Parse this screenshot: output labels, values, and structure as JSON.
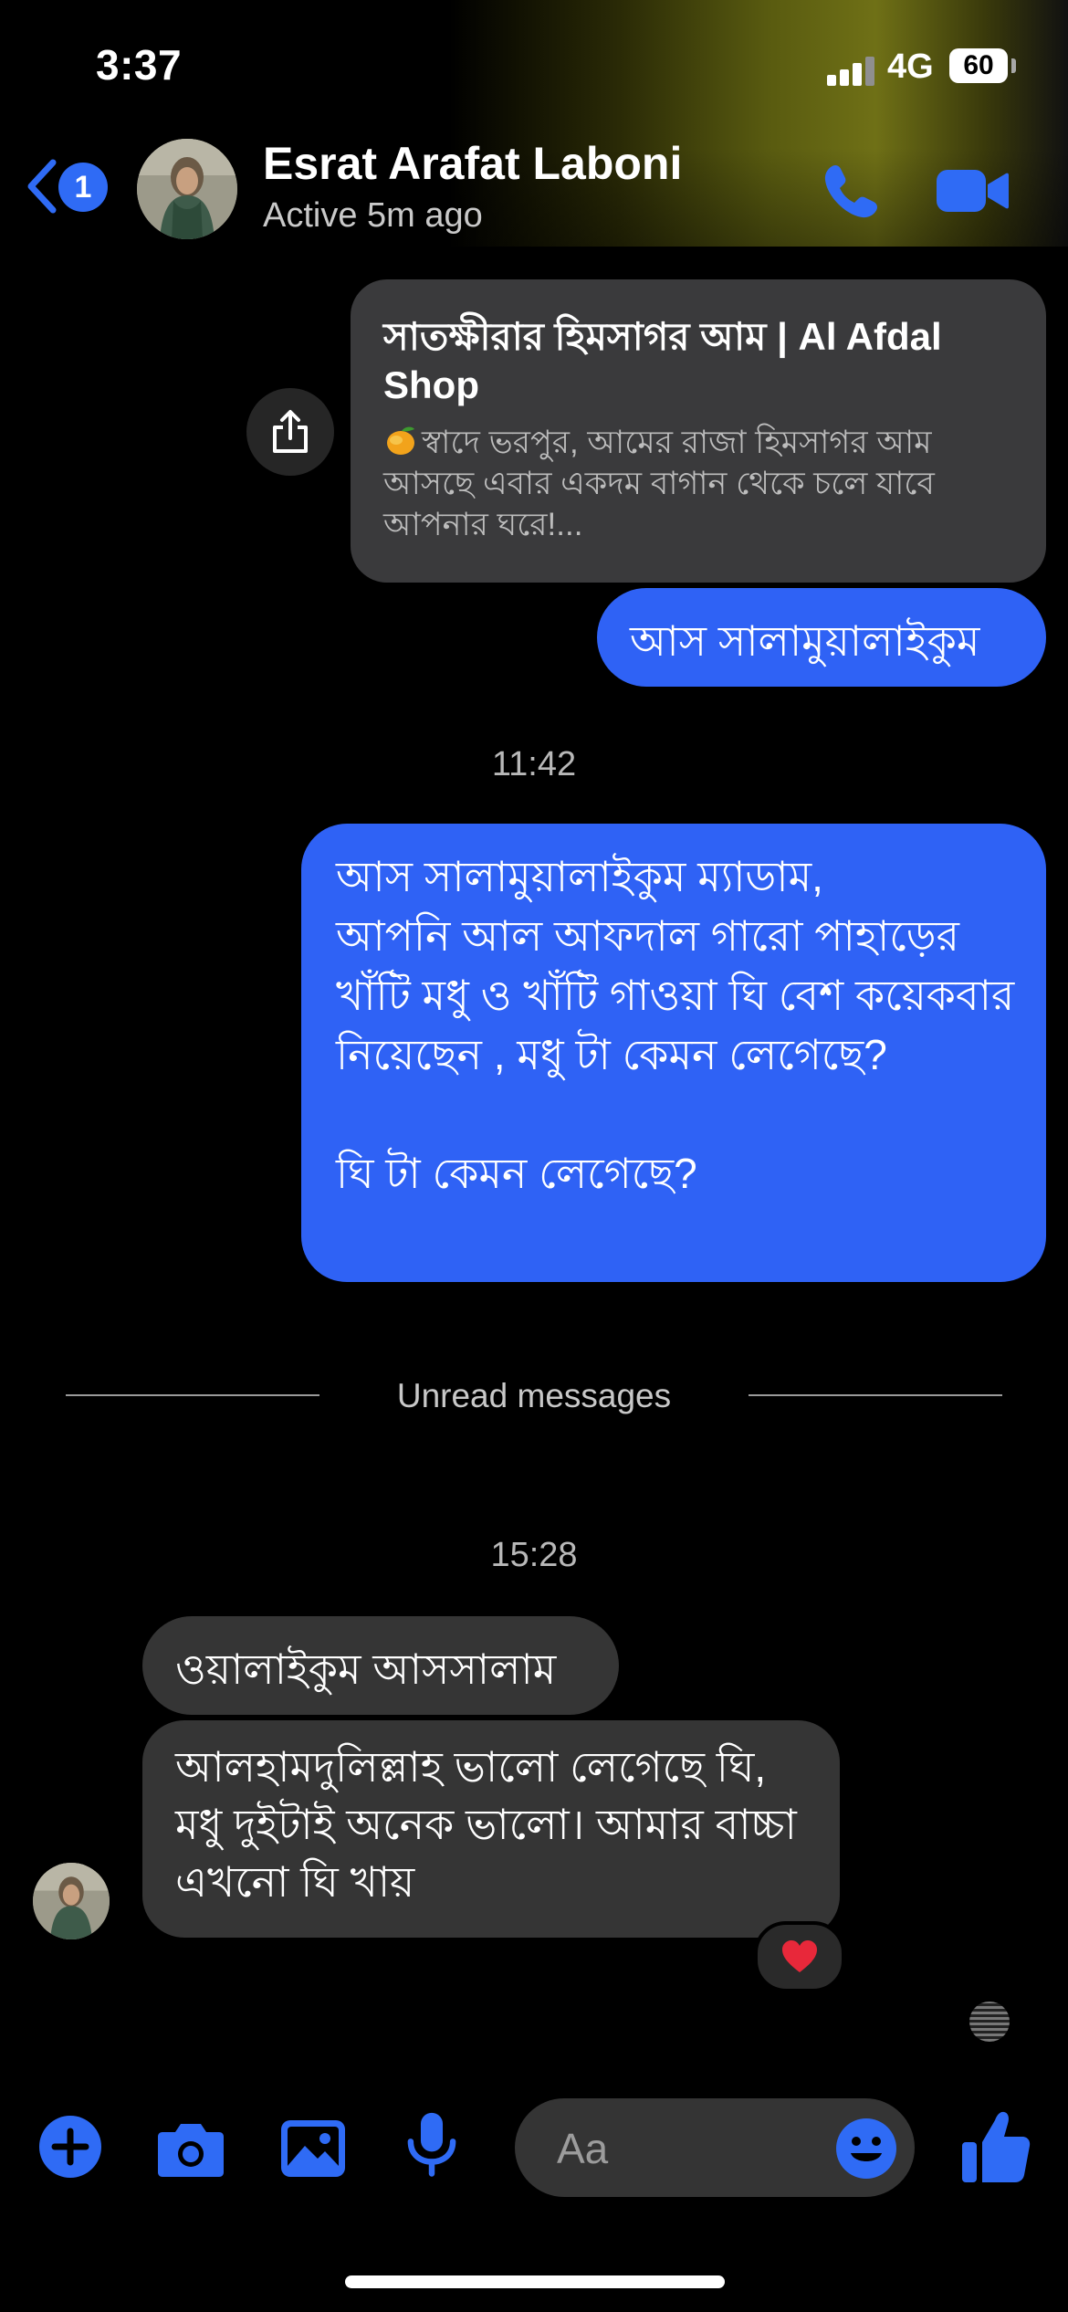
{
  "status_bar": {
    "time": "3:37",
    "network": "4G",
    "battery": "60"
  },
  "header": {
    "back_badge": "1",
    "contact_name": "Esrat Arafat Laboni",
    "contact_status": "Active 5m ago"
  },
  "link_preview": {
    "title": "সাতক্ষীরার হিমসাগর আম | Al Afdal Shop",
    "description": "স্বাদে ভরপুর, আমের রাজা হিমসাগর আম আসছে এবার একদম বাগান থেকে চলে যাবে আপনার ঘরে!..."
  },
  "messages": [
    {
      "from": "me",
      "text": "আস সালামুয়ালাইকুম"
    },
    {
      "timestamp": "11:42"
    },
    {
      "from": "me",
      "text": "আস সালামুয়ালাইকুম ম্যাডাম,\nআপনি আল আফদাল গারো পাহাড়ের খাঁটি মধু ও খাঁটি গাওয়া ঘি বেশ কয়েকবার নিয়েছেন , মধু টা কেমন লেগেছে?\n\nঘি টা কেমন লেগেছে?"
    },
    {
      "divider": "Unread messages"
    },
    {
      "timestamp": "15:28"
    },
    {
      "from": "contact",
      "text": "ওয়ালাইকুম আসসালাম"
    },
    {
      "from": "contact",
      "text": "আলহামদুলিল্লাহ ভালো লেগেছে ঘি, মধু দুইটাই অনেক ভালো। আমার বাচ্চা  এখনো ঘি খায়",
      "reaction": "heart"
    }
  ],
  "composer": {
    "placeholder": "Aa"
  },
  "colors": {
    "accent": "#2f62f5",
    "incoming_bubble": "#353535",
    "background": "#000000"
  },
  "icons": [
    "back-chevron-icon",
    "phone-icon",
    "video-camera-icon",
    "share-icon",
    "plus-icon",
    "camera-icon",
    "image-icon",
    "microphone-icon",
    "emoji-icon",
    "thumbs-up-icon",
    "heart-icon"
  ]
}
